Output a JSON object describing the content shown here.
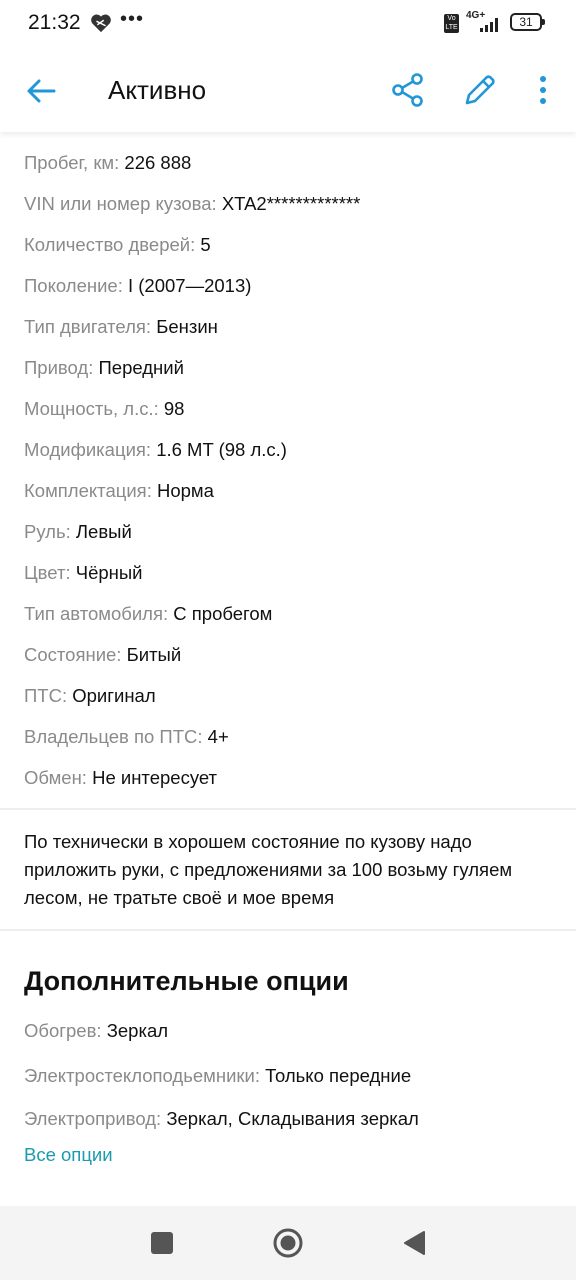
{
  "status_bar": {
    "time": "21:32",
    "net_badge": "Vo LTE",
    "net_type": "4G+",
    "battery": "31"
  },
  "app_bar": {
    "title": "Активно"
  },
  "colors": {
    "accent": "#1a9bb0",
    "icon_blue": "#2196d9",
    "label_gray": "#8a8a8a"
  },
  "specs": [
    {
      "label": "Пробег, км:",
      "value": "226 888"
    },
    {
      "label": "VIN или номер кузова:",
      "value": "XTA2*************"
    },
    {
      "label": "Количество дверей:",
      "value": "5"
    },
    {
      "label": "Поколение:",
      "value": "I (2007—2013)"
    },
    {
      "label": "Тип двигателя:",
      "value": "Бензин"
    },
    {
      "label": "Привод:",
      "value": "Передний"
    },
    {
      "label": "Мощность, л.с.:",
      "value": "98"
    },
    {
      "label": "Модификация:",
      "value": "1.6 MT (98 л.с.)"
    },
    {
      "label": "Комплектация:",
      "value": "Норма"
    },
    {
      "label": "Руль:",
      "value": "Левый"
    },
    {
      "label": "Цвет:",
      "value": "Чёрный"
    },
    {
      "label": "Тип автомобиля:",
      "value": "С пробегом"
    },
    {
      "label": "Состояние:",
      "value": "Битый"
    },
    {
      "label": "ПТС:",
      "value": "Оригинал"
    },
    {
      "label": "Владельцев по ПТС:",
      "value": "4+"
    },
    {
      "label": "Обмен:",
      "value": "Не интересует"
    }
  ],
  "description": "По технически в хорошем состояние по кузову надо приложить руки, с предложениями за 100 возьму гуляем лесом, не тратьте своё и мое время",
  "options": {
    "title": "Дополнительные опции",
    "items": [
      {
        "label": "Обогрев:",
        "value": "Зеркал"
      },
      {
        "label": "Электростеклоподьемники:",
        "value": "Только передние"
      },
      {
        "label": "Электропривод:",
        "value": "Зеркал, Складывания зеркал"
      }
    ],
    "all_link": "Все опции"
  },
  "icons": [
    "arrow-back-icon",
    "share-icon",
    "pencil-icon",
    "more-vert-icon",
    "heart-icon",
    "signal-icon",
    "battery-icon",
    "nav-recent-icon",
    "nav-home-icon",
    "nav-back-icon"
  ]
}
